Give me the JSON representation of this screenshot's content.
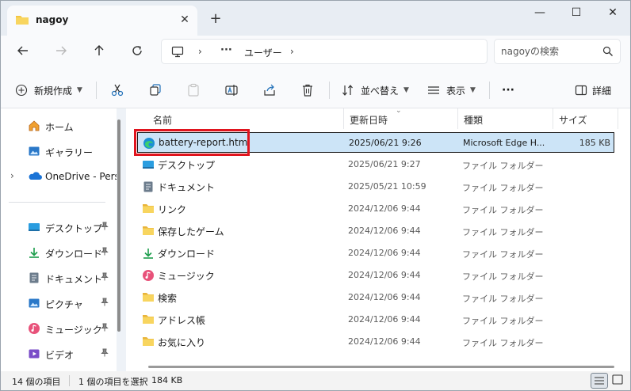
{
  "window": {
    "tab_title": "nagoy",
    "close_tab": "✕",
    "new_tab": "+",
    "minimize": "—",
    "maximize": "☐",
    "close": "✕"
  },
  "address": {
    "sep": "›",
    "more": "···",
    "crumb_user": "ユーザー"
  },
  "search": {
    "placeholder": "nagoyの検索"
  },
  "toolbar": {
    "new_label": "新規作成",
    "sort_label": "並べ替え",
    "view_label": "表示",
    "more": "···",
    "details_label": "詳細"
  },
  "sidebar": {
    "items": [
      {
        "label": "ホーム",
        "icon": "home-icon"
      },
      {
        "label": "ギャラリー",
        "icon": "gallery-icon"
      },
      {
        "label": "OneDrive - Perso",
        "icon": "onedrive-icon",
        "expand": "›"
      },
      {
        "label": "デスクトップ",
        "icon": "desktop-icon",
        "pin": "📌"
      },
      {
        "label": "ダウンロード",
        "icon": "download-icon",
        "pin": "📌"
      },
      {
        "label": "ドキュメント",
        "icon": "document-icon",
        "pin": "📌"
      },
      {
        "label": "ピクチャ",
        "icon": "picture-icon",
        "pin": "📌"
      },
      {
        "label": "ミュージック",
        "icon": "music-icon",
        "pin": "📌"
      },
      {
        "label": "ビデオ",
        "icon": "video-icon",
        "pin": "📌"
      }
    ]
  },
  "columns": {
    "name": "名前",
    "date": "更新日時",
    "type": "種類",
    "size": "サイズ",
    "sort_caret": "⌄"
  },
  "files": [
    {
      "name": "battery-report.html",
      "date": "2025/06/21 9:26",
      "type": "Microsoft Edge H...",
      "size": "185 KB",
      "icon": "edge-icon"
    },
    {
      "name": "デスクトップ",
      "date": "2025/06/21 9:27",
      "type": "ファイル フォルダー",
      "size": "",
      "icon": "desktop-folder-icon"
    },
    {
      "name": "ドキュメント",
      "date": "2025/05/21 10:59",
      "type": "ファイル フォルダー",
      "size": "",
      "icon": "document-folder-icon"
    },
    {
      "name": "リンク",
      "date": "2024/12/06 9:44",
      "type": "ファイル フォルダー",
      "size": "",
      "icon": "folder-icon"
    },
    {
      "name": "保存したゲーム",
      "date": "2024/12/06 9:44",
      "type": "ファイル フォルダー",
      "size": "",
      "icon": "folder-icon"
    },
    {
      "name": "ダウンロード",
      "date": "2024/12/06 9:44",
      "type": "ファイル フォルダー",
      "size": "",
      "icon": "download-folder-icon"
    },
    {
      "name": "ミュージック",
      "date": "2024/12/06 9:44",
      "type": "ファイル フォルダー",
      "size": "",
      "icon": "music-folder-icon"
    },
    {
      "name": "検索",
      "date": "2024/12/06 9:44",
      "type": "ファイル フォルダー",
      "size": "",
      "icon": "folder-icon"
    },
    {
      "name": "アドレス帳",
      "date": "2024/12/06 9:44",
      "type": "ファイル フォルダー",
      "size": "",
      "icon": "folder-icon"
    },
    {
      "name": "お気に入り",
      "date": "2024/12/06 9:44",
      "type": "ファイル フォルダー",
      "size": "",
      "icon": "folder-icon"
    }
  ],
  "status": {
    "item_count": "14 個の項目",
    "selected": "1 個の項目を選択",
    "selected_size": "184 KB"
  },
  "colors": {
    "selection_bg": "#cce4f7",
    "highlight_box": "#e0141e",
    "folder_yellow": "#f4c542"
  }
}
